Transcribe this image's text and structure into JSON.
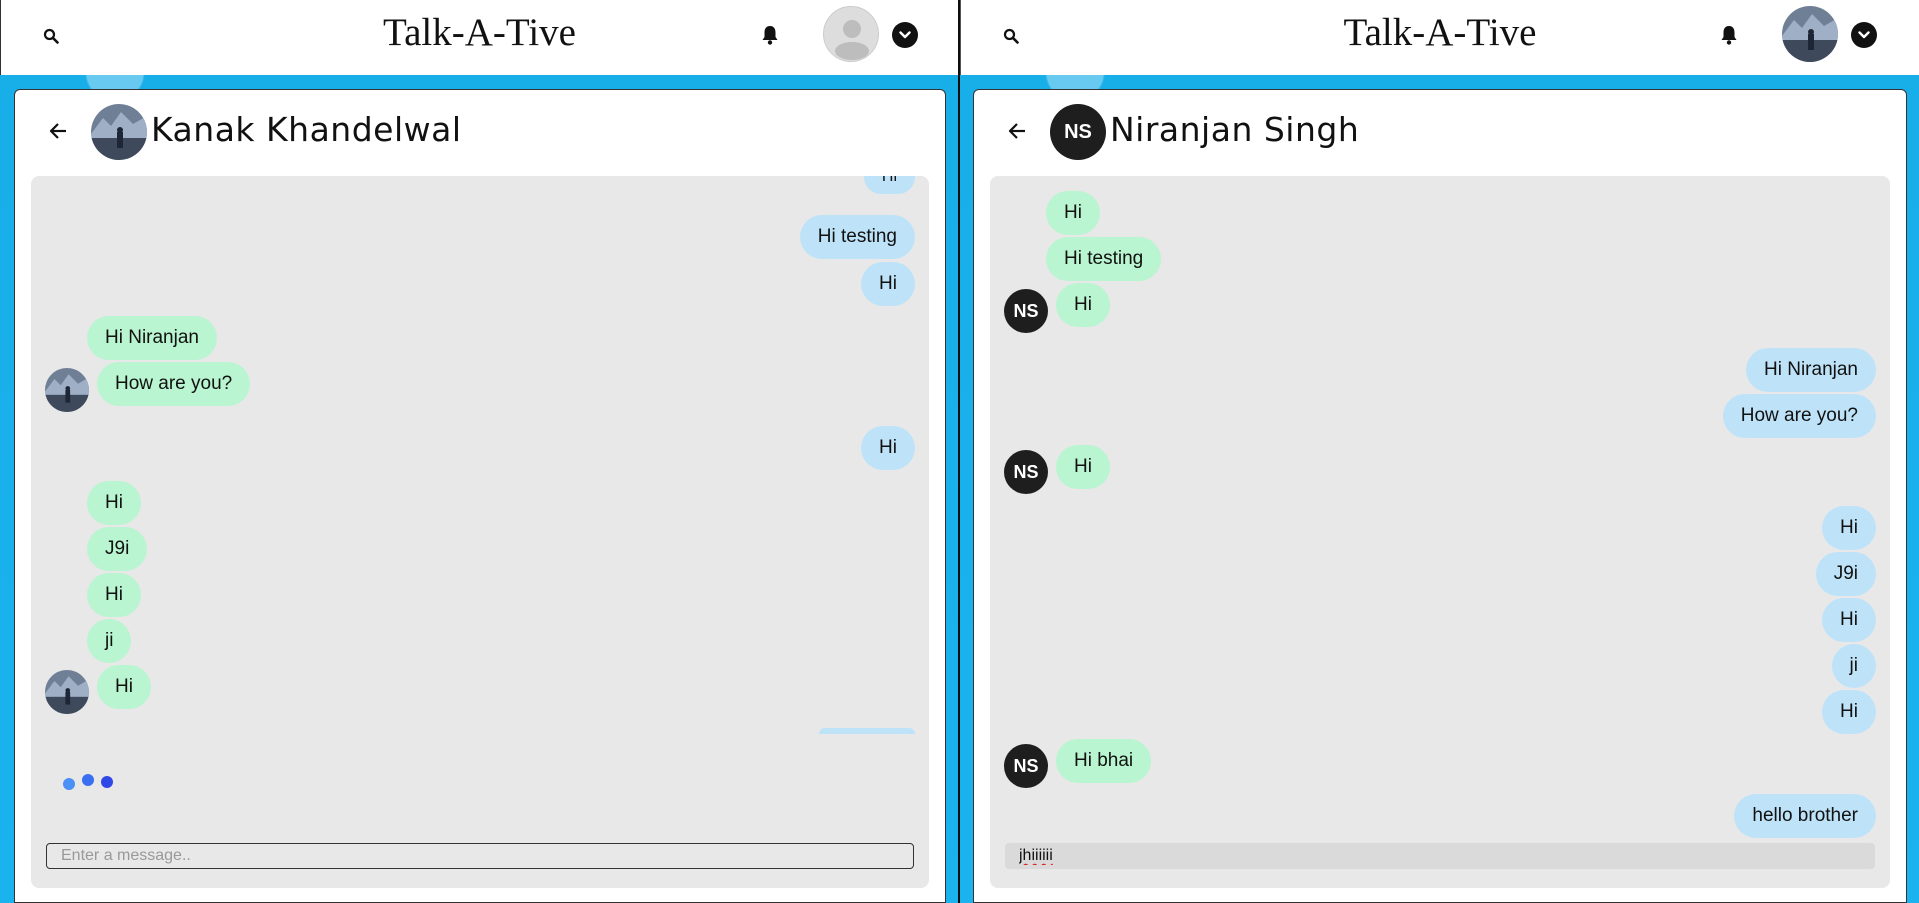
{
  "app": {
    "title": "Talk-A-Tive"
  },
  "colors": {
    "mine_bubble": "#bee3f8",
    "their_bubble": "#b9f5d0",
    "background": "#1fb3ec",
    "chat_area": "#e8e8e8"
  },
  "icons": {
    "search": "search-icon",
    "bell": "bell-icon",
    "chevron": "chevron-down-icon",
    "back": "arrow-left-icon"
  },
  "left": {
    "chat_title": "Kanak Khandelwal",
    "messages": [
      "Hi",
      "Hi testing",
      "Hi",
      "Hi Niranjan",
      "How are you?",
      "Hi",
      "Hi",
      "J9i",
      "Hi",
      "ji",
      "Hi"
    ],
    "typing_indicator": true,
    "input_placeholder": "Enter a message..",
    "input_value": ""
  },
  "right": {
    "chat_title": "Niranjan Singh",
    "avatar_initials": "NS",
    "messages": [
      "Hi",
      "Hi testing",
      "Hi",
      "Hi Niranjan",
      "How are you?",
      "Hi",
      "Hi",
      "J9i",
      "Hi",
      "ji",
      "Hi",
      "Hi bhai",
      "hello brother"
    ],
    "input_value": "jhiiiiii"
  }
}
